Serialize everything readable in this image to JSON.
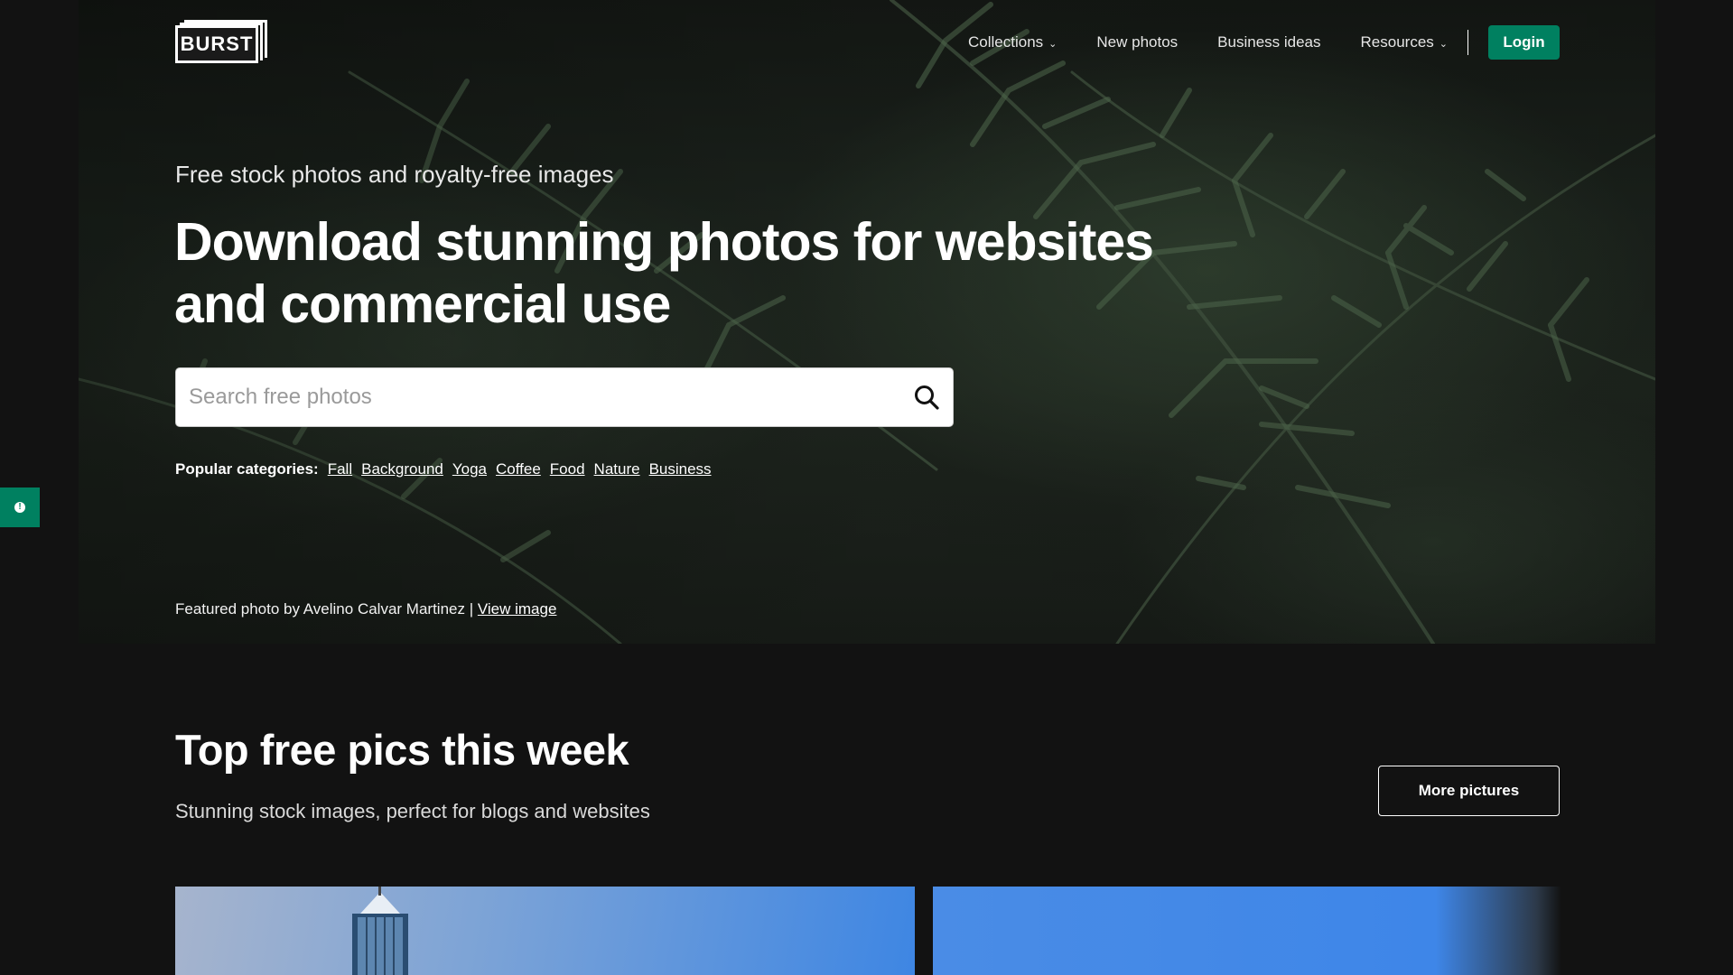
{
  "brand": {
    "logo_text": "BURST",
    "accent": "#008060"
  },
  "nav": {
    "items": [
      {
        "label": "Collections",
        "has_dropdown": true
      },
      {
        "label": "New photos",
        "has_dropdown": false
      },
      {
        "label": "Business ideas",
        "has_dropdown": false
      },
      {
        "label": "Resources",
        "has_dropdown": true
      }
    ],
    "dropdown_icon": "chevron-down-icon",
    "login_label": "Login"
  },
  "hero": {
    "subtitle": "Free stock photos and royalty-free images",
    "headline": "Download stunning photos for websites and commercial use",
    "search": {
      "placeholder": "Search free photos",
      "icon": "search-icon"
    },
    "popular": {
      "label": "Popular categories:",
      "categories": [
        "Fall",
        "Background",
        "Yoga",
        "Coffee",
        "Food",
        "Nature",
        "Business"
      ]
    },
    "featured_credit": "Featured photo by Avelino Calvar Martinez |",
    "view_image_label": "View image"
  },
  "feedback": {
    "icon": "feedback-icon"
  },
  "section": {
    "title": "Top free pics this week",
    "subtitle": "Stunning stock images, perfect for blogs and websites",
    "more_label": "More pictures"
  }
}
